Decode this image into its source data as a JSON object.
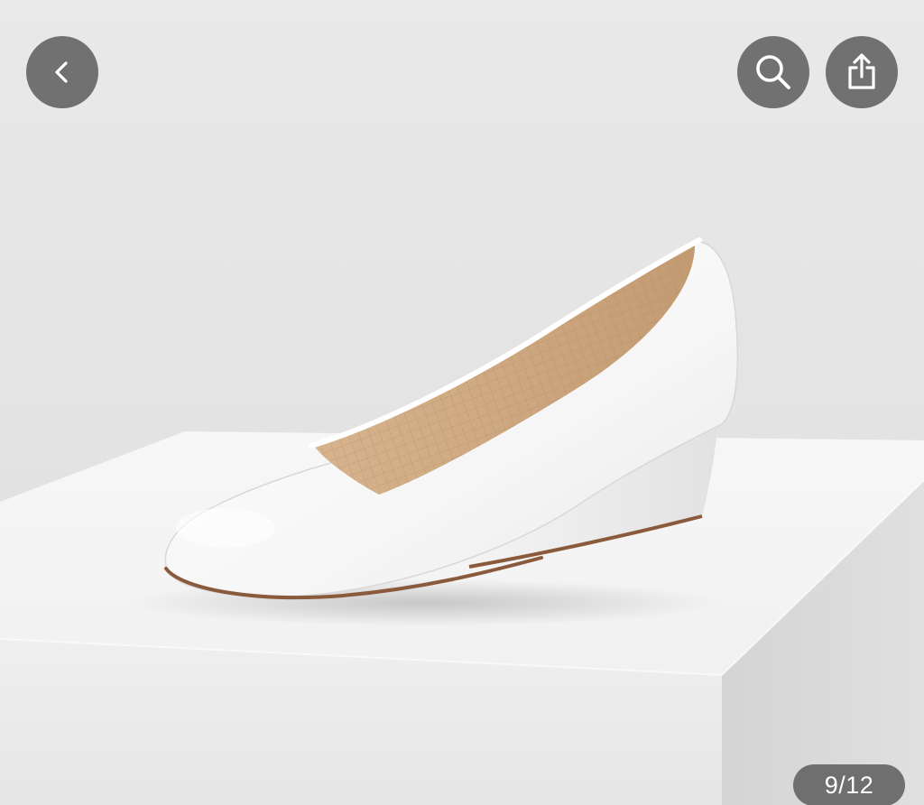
{
  "viewer": {
    "current_page": 9,
    "total_pages": 12,
    "page_indicator": "9/12"
  },
  "toolbar": {
    "back_icon": "chevron-left-icon",
    "search_icon": "search-icon",
    "share_icon": "share-icon"
  },
  "image": {
    "subject": "white-wedge-pump-shoe",
    "colors": {
      "shoe": "#f7f7f7",
      "insole": "#c9a27a",
      "sole_edge": "#8a5a3c",
      "backdrop": "#e4e4e4",
      "pedestal_top": "#f4f4f4",
      "pedestal_side": "#dcdcdc"
    }
  },
  "theme": {
    "overlay_button": "#606060",
    "overlay_icon": "#ffffff"
  }
}
